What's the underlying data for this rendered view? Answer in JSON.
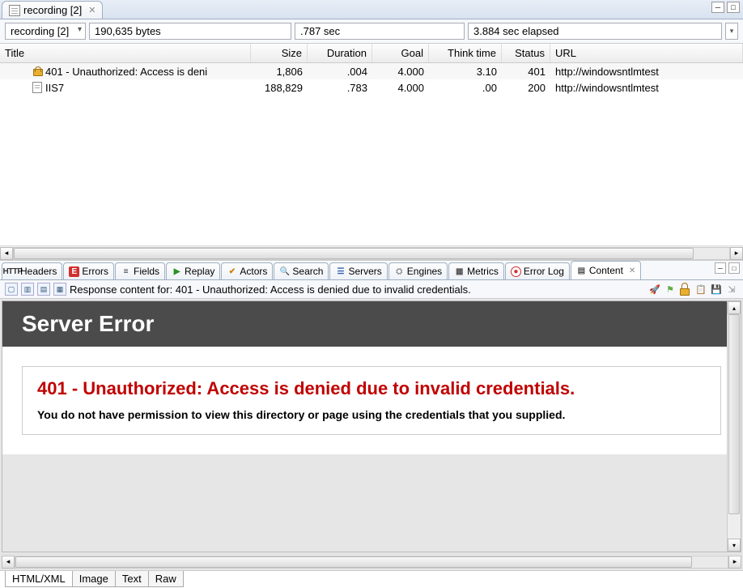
{
  "topTab": {
    "label": "recording [2]"
  },
  "toolbar": {
    "combo": "recording [2]",
    "bytes": "190,635 bytes",
    "sec": ".787 sec",
    "elapsed": "3.884 sec elapsed"
  },
  "grid": {
    "headers": {
      "title": "Title",
      "size": "Size",
      "duration": "Duration",
      "goal": "Goal",
      "think": "Think time",
      "status": "Status",
      "url": "URL"
    },
    "rows": [
      {
        "icon": "lock",
        "title": "401 - Unauthorized: Access is deni",
        "size": "1,806",
        "duration": ".004",
        "goal": "4.000",
        "think": "3.10",
        "status": "401",
        "url": "http://windowsntlmtest"
      },
      {
        "icon": "page",
        "title": "IIS7",
        "size": "188,829",
        "duration": ".783",
        "goal": "4.000",
        "think": ".00",
        "status": "200",
        "url": "http://windowsntlmtest"
      }
    ]
  },
  "midTabs": {
    "headers": "Headers",
    "errors": "Errors",
    "fields": "Fields",
    "replay": "Replay",
    "actors": "Actors",
    "search": "Search",
    "servers": "Servers",
    "engines": "Engines",
    "metrics": "Metrics",
    "errorlog": "Error Log",
    "content": "Content"
  },
  "contentBar": {
    "label": "Response content for: 401 - Unauthorized: Access is denied due to invalid credentials."
  },
  "errorPage": {
    "header": "Server Error",
    "title": "401 - Unauthorized: Access is denied due to invalid credentials.",
    "message": "You do not have permission to view this directory or page using the credentials that you supplied."
  },
  "bottomTabs": {
    "html": "HTML/XML",
    "image": "Image",
    "text": "Text",
    "raw": "Raw"
  }
}
